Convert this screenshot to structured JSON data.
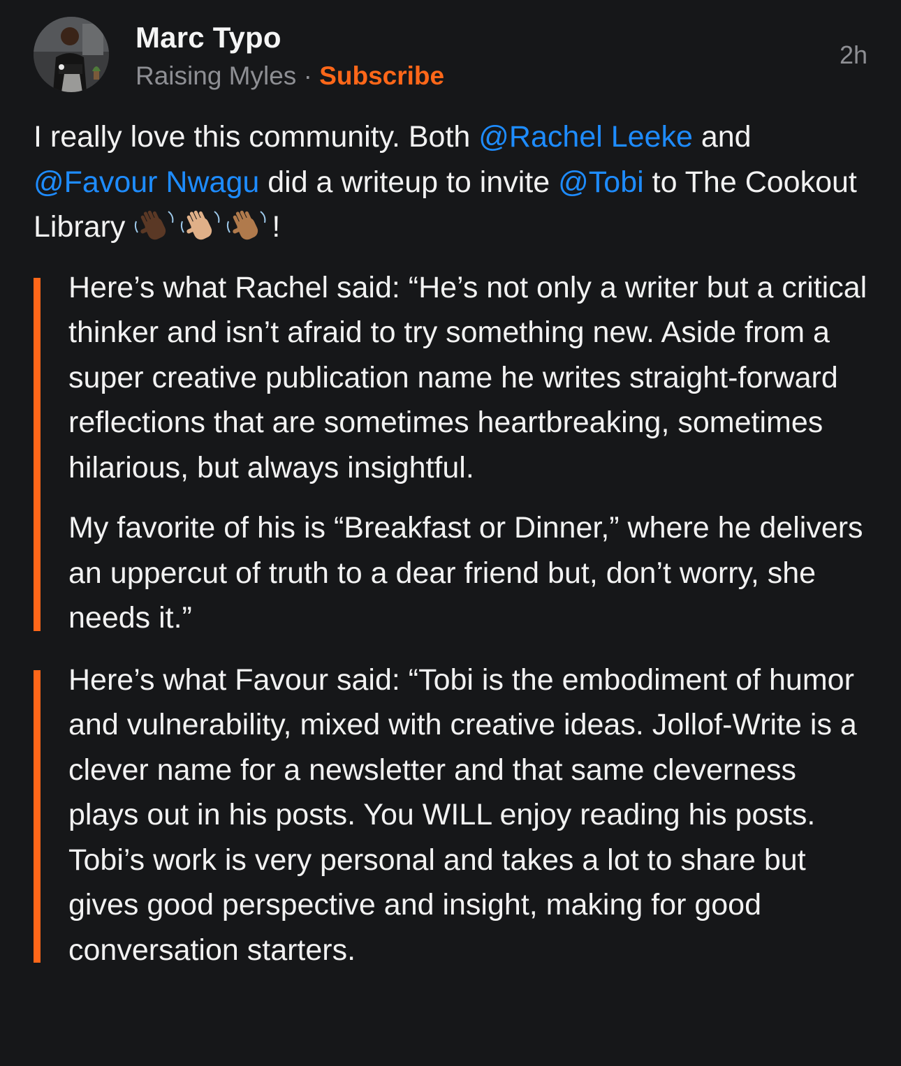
{
  "post": {
    "author": "Marc Typo",
    "publication": "Raising Myles",
    "separator": "·",
    "subscribe_label": "Subscribe",
    "timestamp": "2h",
    "intro": {
      "t1": "I really love this community. Both ",
      "mention1": "@Rachel Leeke",
      "t2": " and ",
      "mention2": "@Favour Nwagu",
      "t3": " did a writeup to invite ",
      "mention3": "@Tobi",
      "t4": " to The Cookout Library ",
      "t5": "!"
    },
    "quote1": {
      "p1": "Here’s what Rachel said: “He’s not only a writer but a critical thinker and isn’t afraid to try something new. Aside from a super creative publication name he writes straight-forward reflections that are sometimes heartbreaking, sometimes hilarious, but always insightful.",
      "p2": "My favorite of his is “Breakfast or Dinner,” where he delivers an uppercut of truth to a dear friend but, don’t worry, she needs it.”"
    },
    "quote2": {
      "p1": "Here’s what Favour said: “Tobi is the embodiment of humor and vulnerability, mixed with creative ideas. Jollof-Write is a clever name for a newsletter and that same cleverness plays out in his posts. You WILL enjoy reading his posts. Tobi’s work is very personal and takes a lot to share but gives good perspective and insight, making for good conversation starters."
    },
    "emojis": [
      "waving-hand-dark-skin-icon",
      "waving-hand-medium-light-skin-icon",
      "waving-hand-medium-skin-icon"
    ],
    "colors": {
      "background": "#161719",
      "accent": "#ff6719",
      "mention": "#1e8cff",
      "meta": "#8e8f94"
    }
  }
}
